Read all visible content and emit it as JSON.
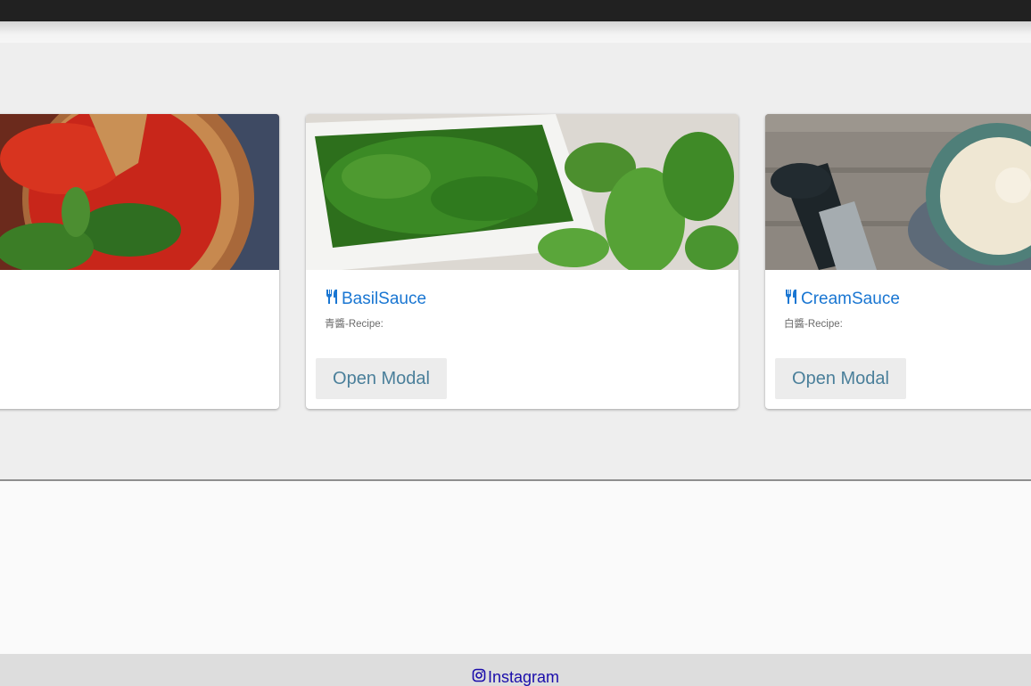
{
  "cards": [
    {
      "title": "",
      "subtitle": "",
      "button_label": ""
    },
    {
      "title": "BasilSauce",
      "subtitle": "青醬-Recipe:",
      "button_label": "Open Modal"
    },
    {
      "title": "CreamSauce",
      "subtitle": "白醬-Recipe:",
      "button_label": "Open Modal"
    }
  ],
  "icons": {
    "card_title": "utensils-icon",
    "footer_link": "instagram-icon"
  },
  "colors": {
    "title": "#1976d2",
    "button_text": "#4a7f9a",
    "link": "#1a0dab"
  },
  "footer": {
    "link_label": "Instagram"
  }
}
